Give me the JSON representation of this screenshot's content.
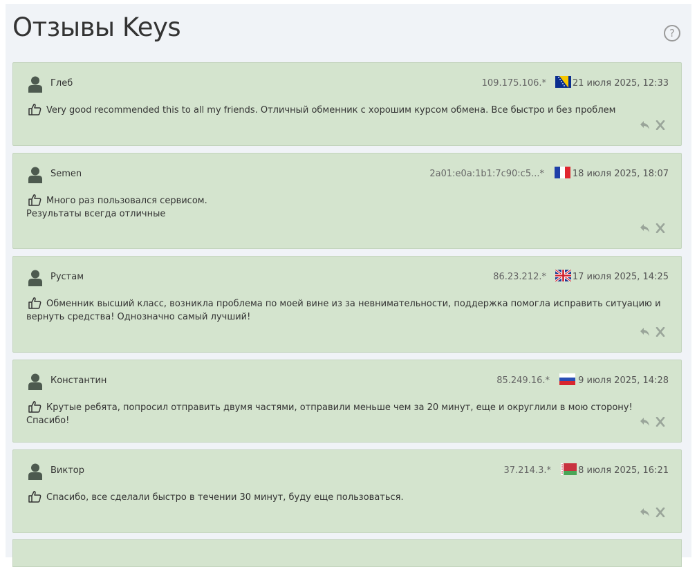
{
  "page": {
    "title": "Отзывы Keys",
    "help_label": "?"
  },
  "reviews": [
    {
      "author": "Глеб",
      "ip": "109.175.106.*",
      "flag": "bosnia-flag",
      "date": "21 июля 2025, 12:33",
      "text": "Very good recommended this to all my friends. Отличный обменник с хорошим курсом обмена. Все быстро и без проблем"
    },
    {
      "author": "Semen",
      "ip": "2a01:e0a:1b1:7c90:c5...*",
      "flag": "france-flag",
      "date": "18 июля 2025, 18:07",
      "text": "Много раз пользовался сервисом.\nРезультаты всегда отличные"
    },
    {
      "author": "Рустам",
      "ip": "86.23.212.*",
      "flag": "uk-flag",
      "date": "17 июля 2025, 14:25",
      "text": "Обменник высший класс, возникла проблема по моей вине из за невнимательности, поддержка помогла исправить ситуацию и вернуть средства! Однозначно самый лучший!"
    },
    {
      "author": "Константин",
      "ip": "85.249.16.*",
      "flag": "russia-flag",
      "date": "9 июля 2025, 14:28",
      "text": "Крутые ребята, попросил отправить двумя частями, отправили меньше чем за 20 минут, еще и округлили в мою сторону! Спасибо!"
    },
    {
      "author": "Виктор",
      "ip": "37.214.3.*",
      "flag": "belarus-flag",
      "date": "8 июля 2025, 16:21",
      "text": "Спасибо, все сделали быстро в течении 30 минут, буду еще пользоваться."
    }
  ],
  "colors": {
    "card_bg": "#d4e4ce",
    "panel_bg": "#f0f3f7",
    "icon": "#4d5a4f"
  }
}
